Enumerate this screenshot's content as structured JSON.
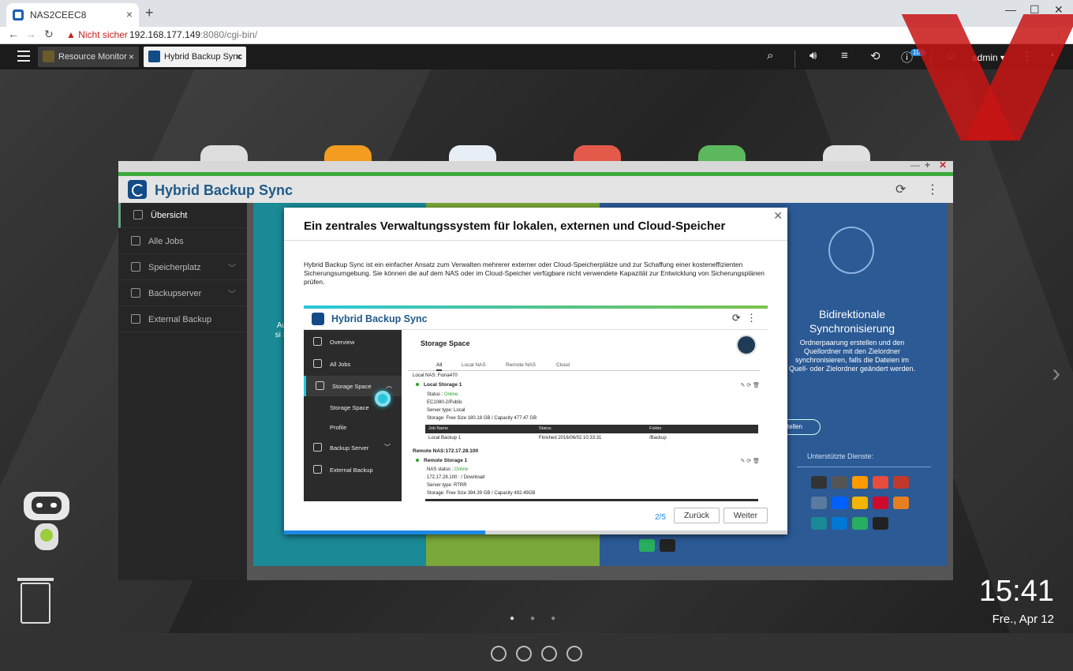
{
  "browser": {
    "tab_title": "NAS2CEEC8",
    "security_warning": "Nicht sicher",
    "url_host": "192.168.177.149",
    "url_path": ":8080/cgi-bin/"
  },
  "qts": {
    "tabs": [
      {
        "label": "Resource Monitor"
      },
      {
        "label": "Hybrid Backup Sync"
      }
    ],
    "notification_badge": "10+",
    "user": "admin ▾"
  },
  "hbs_window": {
    "title": "Hybrid Backup Sync",
    "sidebar": [
      {
        "label": "Übersicht"
      },
      {
        "label": "Alle Jobs"
      },
      {
        "label": "Speicherplatz"
      },
      {
        "label": "Backupserver"
      },
      {
        "label": "External Backup"
      }
    ],
    "background": {
      "sync_title": "Bidirektionale Synchronisierung",
      "sync_desc": "Ordnerpaarung erstellen und den Quellordner mit den Zielordner synchronisieren, falls die Dateien im Quell- oder Zielordner geändert werden.",
      "sync_button": "rag erstellen",
      "services_label": "Unterstützte Dienste:",
      "left_fragment": "Au si S"
    }
  },
  "modal": {
    "title": "Ein zentrales Verwaltungssystem für lokalen, externen und Cloud-Speicher",
    "description": "Hybrid Backup Sync ist ein einfacher Ansatz zum Verwalten mehrerer externer oder Cloud-Speicherplätze und zur Schaffung einer kosteneffizienten Sicherungsumgebung. Sie können die auf dem NAS oder im Cloud-Speicher verfügbare nicht verwendete Kapazität zur Entwicklung von Sicherungsplänen prüfen.",
    "page": "2/5",
    "progress": 0.4,
    "back_label": "Zurück",
    "next_label": "Weiter",
    "screenshot": {
      "title": "Hybrid Backup Sync",
      "sidebar": [
        {
          "label": "Overview"
        },
        {
          "label": "All Jobs"
        },
        {
          "label": "Storage Space"
        },
        {
          "label": "Storage Space"
        },
        {
          "label": "Profile"
        },
        {
          "label": "Backup Server"
        },
        {
          "label": "External Backup"
        }
      ],
      "content_title": "Storage Space",
      "tabs": [
        "All",
        "Local NAS",
        "Remote NAS",
        "Cloud"
      ],
      "local_header": "Local NAS: Fiona470",
      "local_storage": "Local Storage 1",
      "local_status_label": "Status : ",
      "local_status_value": "Online",
      "local_path": "EC1080-2/Public",
      "local_server_type": "Server type: Local",
      "local_storage_info": "Storage: Free Size 180.18 GB / Capacity 477.47 GB",
      "table_headers": [
        "Job Name",
        "Status",
        "Folder"
      ],
      "table_row": [
        "Local Backup 1",
        "Finished 2016/06/02 10:33:31",
        "/Backup"
      ],
      "remote_header": "Remote NAS:172.17.28.100",
      "remote_storage": "Remote Storage 1",
      "remote_status_label": "NAS status : ",
      "remote_status_value": "Online",
      "remote_path": "172.17.28.100 : / Download",
      "remote_server_type": "Server type: RTRR",
      "remote_storage_info": "Storage: Free Size 394.39 GB / Capacity 492.49GB"
    }
  },
  "desktop": {
    "time": "15:41",
    "date": "Fre., Apr 12"
  },
  "colors": {
    "hbs_blue": "#1f5a8a",
    "accent_green": "#3daa3d",
    "panel_teal": "#1a8a96",
    "panel_green": "#7aa83a",
    "panel_blue": "#2b5a95",
    "progress_blue": "#1e88e5"
  }
}
